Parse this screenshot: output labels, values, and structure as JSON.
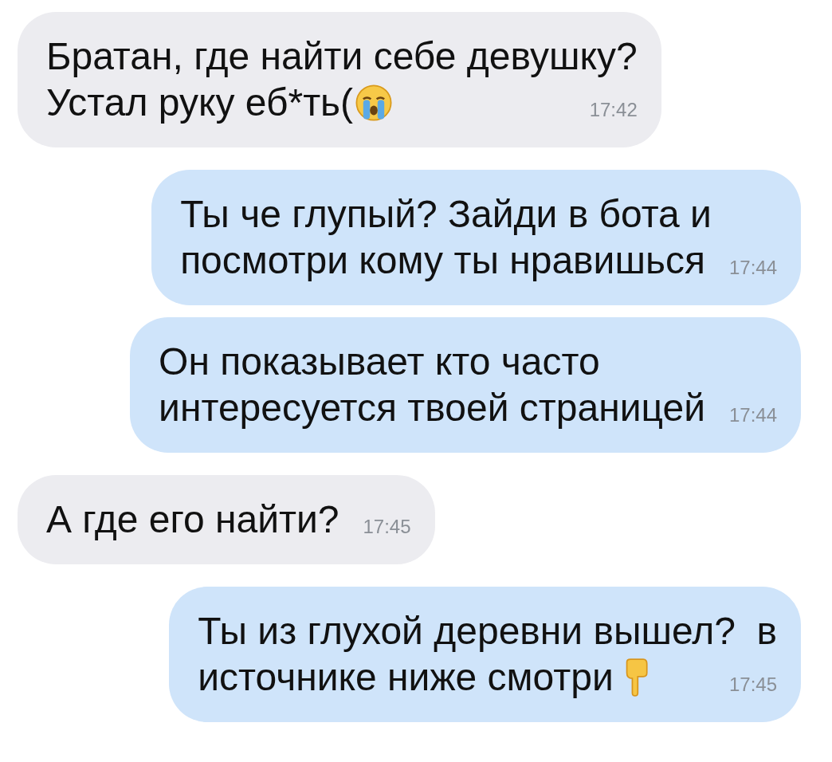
{
  "messages": [
    {
      "kind": "incoming",
      "lines": [
        "Братан, где найти себе девушку?",
        "Устал руку еб*ть("
      ],
      "icon": true,
      "time": "17:42"
    },
    {
      "kind": "outgoing",
      "lines": [
        "Ты че глупый? Зайди в бота и",
        "посмотри кому ты нравишься"
      ],
      "icon": false,
      "time": "17:44"
    },
    {
      "kind": "outgoing",
      "lines": [
        "Он показывает кто часто",
        "интересуется твоей страницей"
      ],
      "icon": false,
      "time": "17:44"
    },
    {
      "kind": "incoming",
      "lines": [
        "А где его найти?"
      ],
      "icon": false,
      "time": "17:45"
    },
    {
      "kind": "outgoing",
      "lines": [
        "Ты из глухой деревни вышел?  в",
        "источнике ниже смотри"
      ],
      "icon": true,
      "time": "17:45"
    }
  ]
}
